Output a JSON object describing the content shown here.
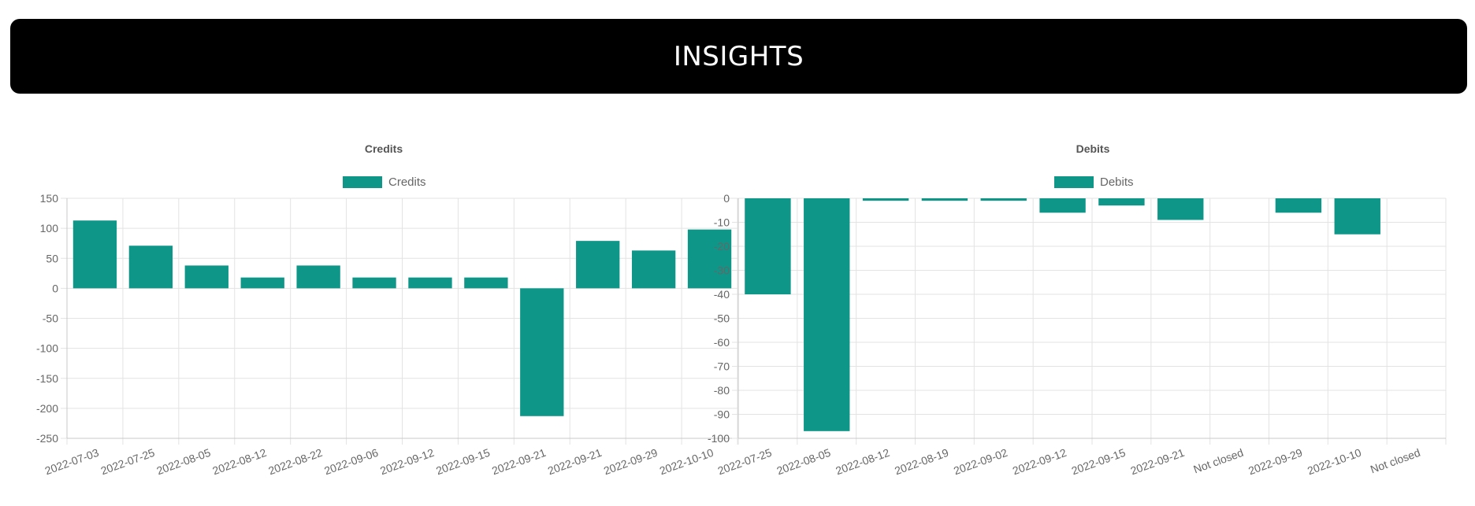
{
  "header": {
    "title": "INSIGHTS"
  },
  "colors": {
    "bar": "#0e9688",
    "banner": "#000000"
  },
  "chart_data": [
    {
      "type": "bar",
      "title": "Credits",
      "legend": {
        "label": "Credits",
        "position": "top"
      },
      "categories": [
        "2022-07-03",
        "2022-07-25",
        "2022-08-05",
        "2022-08-12",
        "2022-08-22",
        "2022-09-06",
        "2022-09-12",
        "2022-09-15",
        "2022-09-21",
        "2022-09-21",
        "2022-09-29",
        "2022-10-10"
      ],
      "series": [
        {
          "name": "Credits",
          "values": [
            113,
            71,
            38,
            18,
            38,
            18,
            18,
            18,
            -213,
            79,
            63,
            98
          ]
        }
      ],
      "ylim": [
        -250,
        150
      ],
      "yticks": [
        "150",
        "100",
        "50",
        "0",
        "-50",
        "-100",
        "-150",
        "-200",
        "-250"
      ],
      "grid": true
    },
    {
      "type": "bar",
      "title": "Debits",
      "legend": {
        "label": "Debits",
        "position": "top"
      },
      "categories": [
        "2022-07-25",
        "2022-08-05",
        "2022-08-12",
        "2022-08-19",
        "2022-09-02",
        "2022-09-12",
        "2022-09-15",
        "2022-09-21",
        "Not closed",
        "2022-09-29",
        "2022-10-10",
        "Not closed"
      ],
      "series": [
        {
          "name": "Debits",
          "values": [
            -40,
            -97,
            -1,
            -1,
            -1,
            -6,
            -3,
            -9,
            0,
            -6,
            -15,
            0
          ]
        }
      ],
      "ylim": [
        -100,
        0
      ],
      "yticks": [
        "0",
        "-10",
        "-20",
        "-30",
        "-40",
        "-50",
        "-60",
        "-70",
        "-80",
        "-90",
        "-100"
      ],
      "grid": true
    }
  ]
}
